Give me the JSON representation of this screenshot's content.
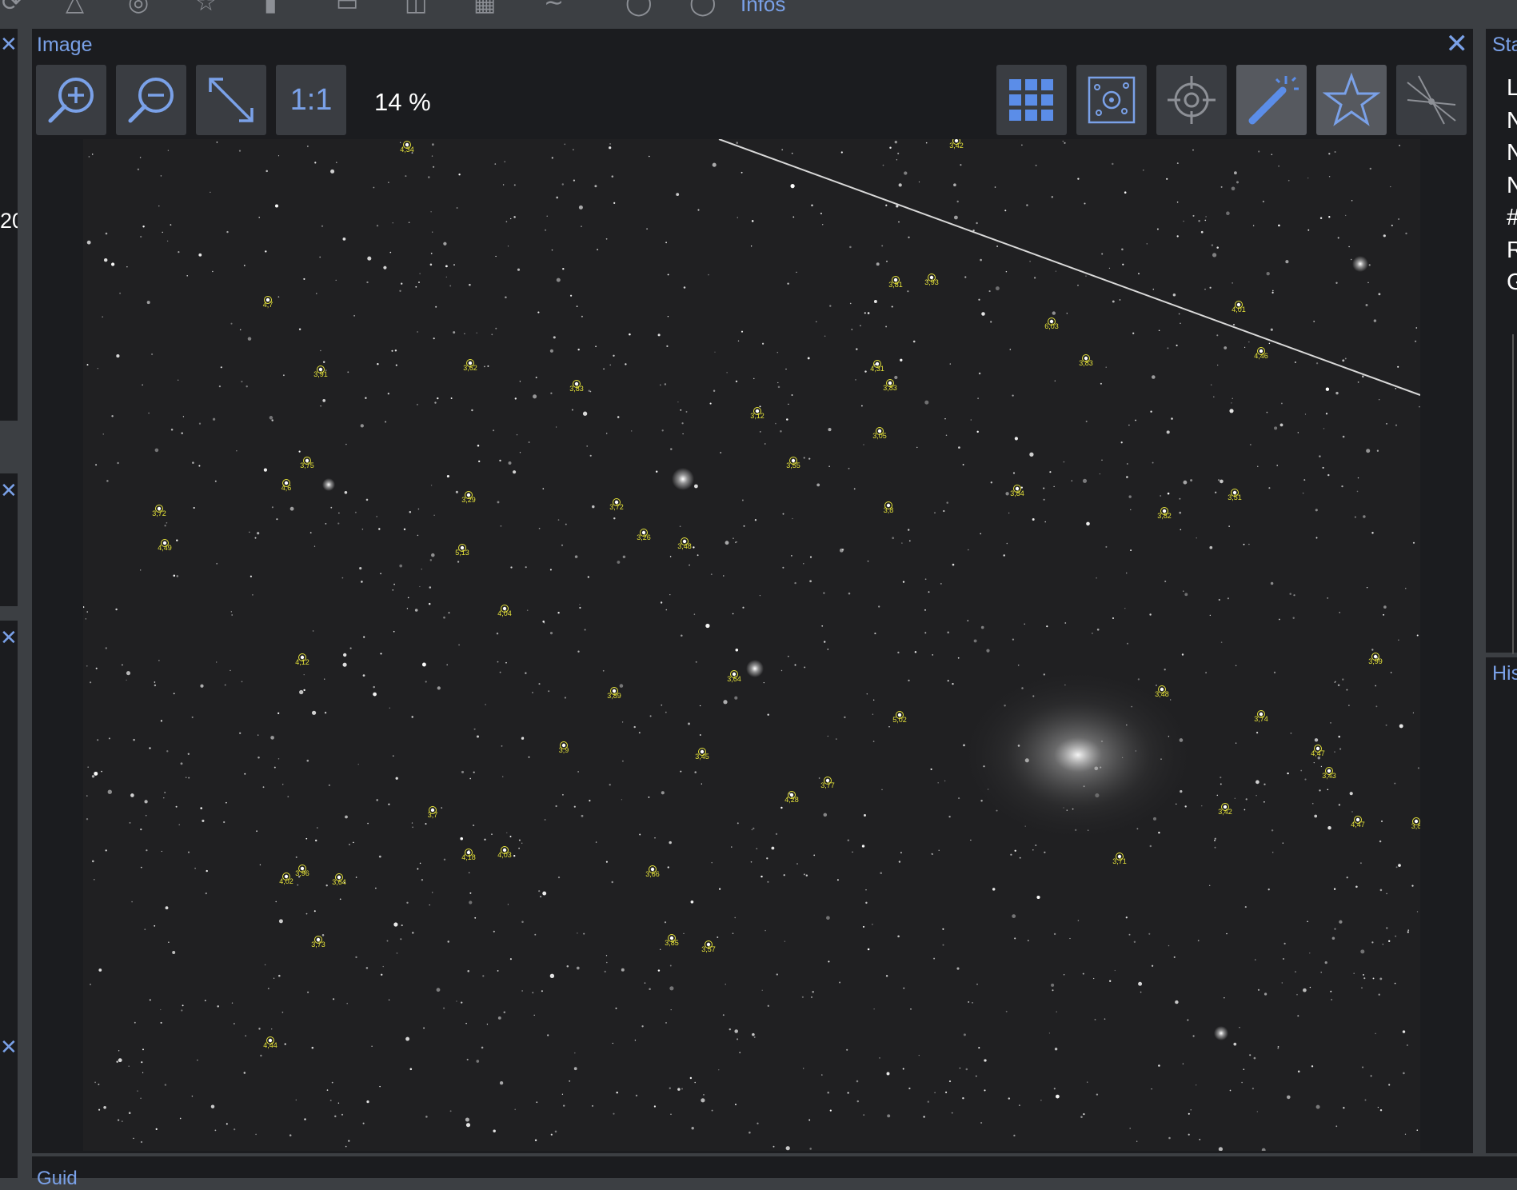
{
  "app": {
    "top_toolbar_label": "Infos"
  },
  "image_panel": {
    "title": "Image",
    "zoom_level": "14 %",
    "one_to_one_label": "1:1"
  },
  "stats_panel": {
    "title": "Sta",
    "row_initials": [
      "L",
      "N",
      "N",
      "N",
      "#",
      "R",
      "G"
    ]
  },
  "histogram_panel": {
    "title": "His"
  },
  "bottom_panel": {
    "title": "Guid"
  },
  "left_strip_text": "20",
  "colors": {
    "accent": "#7aa1e8",
    "panel_bg": "#1b1c1f",
    "app_bg": "#3c3f43",
    "annotation": "#e5e23a"
  },
  "star_annotations": [
    {
      "label": "4,34"
    },
    {
      "label": "3,42"
    },
    {
      "label": "4,7"
    },
    {
      "label": "3,81"
    },
    {
      "label": "3,93"
    },
    {
      "label": "6,03"
    },
    {
      "label": "4,01"
    },
    {
      "label": "4,46"
    },
    {
      "label": "3,83"
    },
    {
      "label": "3,91"
    },
    {
      "label": "3,62"
    },
    {
      "label": "3,83"
    },
    {
      "label": "4,31"
    },
    {
      "label": "3,83"
    },
    {
      "label": "3,12"
    },
    {
      "label": "3,05"
    },
    {
      "label": "3,75"
    },
    {
      "label": "3,55"
    },
    {
      "label": "4,6"
    },
    {
      "label": "3,72"
    },
    {
      "label": "3,29"
    },
    {
      "label": "3,72"
    },
    {
      "label": "3,84"
    },
    {
      "label": "3,8"
    },
    {
      "label": "3,51"
    },
    {
      "label": "3,82"
    },
    {
      "label": "3,26"
    },
    {
      "label": "3,48"
    },
    {
      "label": "4,49"
    },
    {
      "label": "5,13"
    },
    {
      "label": "4,04"
    },
    {
      "label": "4,12"
    },
    {
      "label": "3,64"
    },
    {
      "label": "3,89"
    },
    {
      "label": "3,48"
    },
    {
      "label": "3,99"
    },
    {
      "label": "5,02"
    },
    {
      "label": "3,74"
    },
    {
      "label": "3,9"
    },
    {
      "label": "3,45"
    },
    {
      "label": "4,47"
    },
    {
      "label": "3,43"
    },
    {
      "label": "3,77"
    },
    {
      "label": "4,28"
    },
    {
      "label": "3,7"
    },
    {
      "label": "3,42"
    },
    {
      "label": "4,47"
    },
    {
      "label": "3,8"
    },
    {
      "label": "4,18"
    },
    {
      "label": "4,03"
    },
    {
      "label": "3,71"
    },
    {
      "label": "3,96"
    },
    {
      "label": "4,02"
    },
    {
      "label": "3,64"
    },
    {
      "label": "3,66"
    },
    {
      "label": "3,73"
    },
    {
      "label": "3,85"
    },
    {
      "label": "3,57"
    },
    {
      "label": "4,44"
    }
  ]
}
